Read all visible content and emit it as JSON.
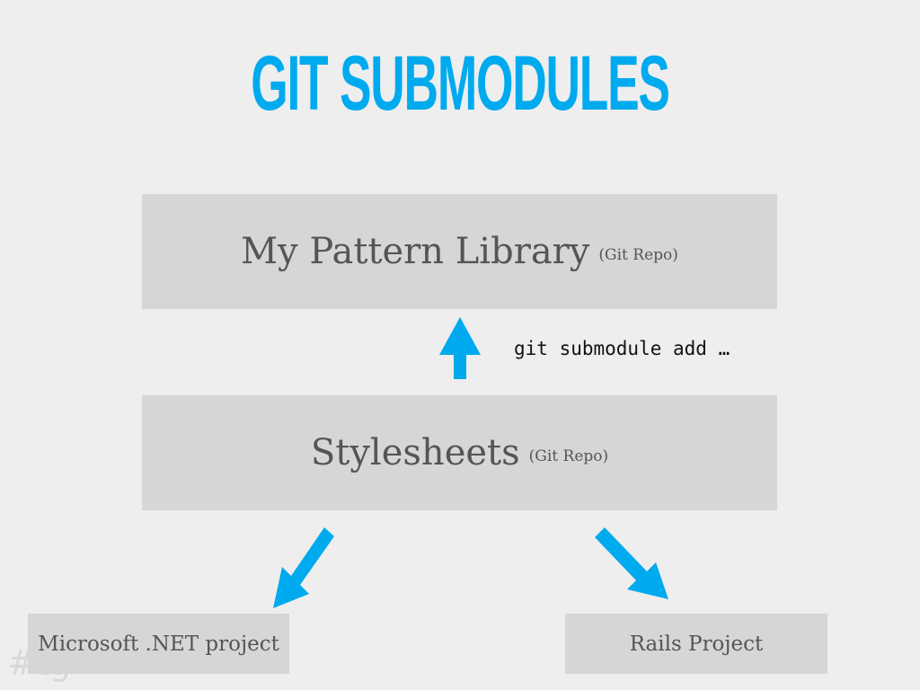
{
  "colors": {
    "background": "#eeeeee",
    "accent": "#00aaee",
    "box_fill": "#d6d6d6",
    "box_text": "#555555",
    "command_text": "#111111",
    "footer_text": "#d8d8d8"
  },
  "slide": {
    "title": "GIT SUBMODULES",
    "footer_tag": "#tg"
  },
  "diagram": {
    "nodes": {
      "pattern_library": {
        "label": "My Pattern Library",
        "note": "(Git Repo)"
      },
      "stylesheets": {
        "label": "Stylesheets",
        "note": "(Git Repo)"
      },
      "dotnet_project": {
        "label": "Microsoft .NET project"
      },
      "rails_project": {
        "label": "Rails Project"
      }
    },
    "edges": [
      {
        "from": "stylesheets",
        "to": "pattern_library",
        "label": "git submodule add …",
        "icon": "arrow-up-icon"
      },
      {
        "from": "stylesheets",
        "to": "dotnet_project",
        "icon": "arrow-down-left-icon"
      },
      {
        "from": "stylesheets",
        "to": "rails_project",
        "icon": "arrow-down-right-icon"
      }
    ]
  }
}
